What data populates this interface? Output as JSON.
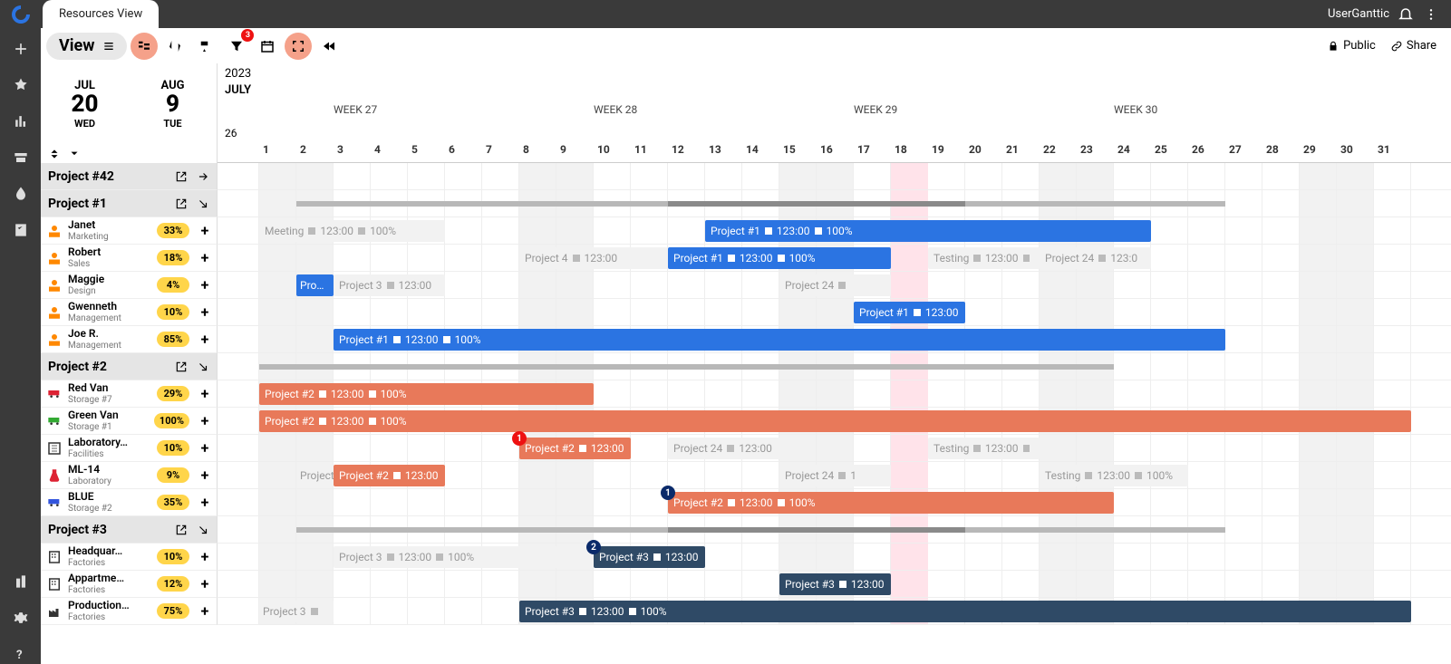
{
  "topbar": {
    "tab": "Resources View",
    "user": "UserGanttic"
  },
  "toolbar": {
    "view": "View",
    "filter_badge": "3",
    "public": "Public",
    "share": "Share"
  },
  "date_left": {
    "month": "JUL",
    "day": "20",
    "wday": "WED"
  },
  "date_right": {
    "month": "AUG",
    "day": "9",
    "wday": "TUE"
  },
  "year": "2023",
  "month_label": "JULY",
  "start_day": "26",
  "weeks": [
    "WEEK 27",
    "WEEK 28",
    "WEEK 29",
    "WEEK 30"
  ],
  "days": [
    "1",
    "2",
    "3",
    "4",
    "5",
    "6",
    "7",
    "8",
    "9",
    "10",
    "11",
    "12",
    "13",
    "14",
    "15",
    "16",
    "17",
    "18",
    "19",
    "20",
    "21",
    "22",
    "23",
    "24",
    "25",
    "26",
    "27",
    "28",
    "29",
    "30",
    "31"
  ],
  "groups": [
    {
      "name": "Project #42",
      "collapsed": false,
      "arrow": "right",
      "summary": []
    },
    {
      "name": "Project #1",
      "collapsed": false,
      "arrow": "down",
      "summary": [
        {
          "start": 1,
          "end": 11,
          "shade": "light"
        },
        {
          "start": 11,
          "end": 19,
          "shade": "dark"
        },
        {
          "start": 19,
          "end": 26,
          "shade": "light"
        }
      ],
      "resources": [
        {
          "name": "Janet",
          "role": "Marketing",
          "util": "33%",
          "icon": "person-orange",
          "tasks": [
            {
              "label": "Meeting ◼ 123:00 ◼ 100%",
              "start": 0,
              "end": 5,
              "cls": "ghost"
            },
            {
              "label": "Project #1 ◼ 123:00 ◼ 100%",
              "start": 12,
              "end": 24,
              "cls": "blue"
            }
          ]
        },
        {
          "name": "Robert",
          "role": "Sales",
          "util": "18%",
          "icon": "person-orange",
          "tasks": [
            {
              "label": "Project 4 ◼ 123:00",
              "start": 7,
              "end": 11,
              "cls": "ghost"
            },
            {
              "label": "Project #1 ◼ 123:00 ◼ 100%",
              "start": 11,
              "end": 17,
              "cls": "blue"
            },
            {
              "label": "Testing ◼ 123:00 ◼",
              "start": 18,
              "end": 21,
              "cls": "ghost"
            },
            {
              "label": "Project 24 ◼ 123:0",
              "start": 21,
              "end": 24,
              "cls": "ghost"
            }
          ]
        },
        {
          "name": "Maggie",
          "role": "Design",
          "util": "4%",
          "icon": "person-orange",
          "tasks": [
            {
              "label": "Pro…",
              "start": 1,
              "end": 2,
              "cls": "blue tiny"
            },
            {
              "label": "Project 3 ◼ 123:00",
              "start": 2,
              "end": 5,
              "cls": "ghost"
            },
            {
              "label": "Project 24 ◼",
              "start": 14,
              "end": 17,
              "cls": "ghost"
            }
          ]
        },
        {
          "name": "Gwenneth",
          "role": "Management",
          "util": "10%",
          "icon": "person-orange",
          "tasks": [
            {
              "label": "Project #1 ◼ 123:00",
              "start": 16,
              "end": 19,
              "cls": "blue"
            }
          ]
        },
        {
          "name": "Joe R.",
          "role": "Management",
          "util": "85%",
          "icon": "person-orange",
          "tasks": [
            {
              "label": "Project #1 ◼ 123:00 ◼ 100%",
              "start": 2,
              "end": 26,
              "cls": "blue"
            }
          ]
        }
      ]
    },
    {
      "name": "Project #2",
      "collapsed": false,
      "arrow": "down",
      "summary": [
        {
          "start": 0,
          "end": 9,
          "shade": "light"
        },
        {
          "start": 9,
          "end": 23,
          "shade": "light"
        }
      ],
      "resources": [
        {
          "name": "Red Van",
          "role": "Storage #7",
          "util": "29%",
          "icon": "van-red",
          "tasks": [
            {
              "label": "Project #2 ◼ 123:00 ◼ 100%",
              "start": 0,
              "end": 9,
              "cls": "orange"
            }
          ]
        },
        {
          "name": "Green Van",
          "role": "Storage #1",
          "util": "100%",
          "icon": "van-green",
          "tasks": [
            {
              "label": "Project #2 ◼ 123:00 ◼ 100%",
              "start": 0,
              "end": 31,
              "cls": "orange"
            }
          ]
        },
        {
          "name": "Laboratory…",
          "role": "Facilities",
          "util": "10%",
          "icon": "lab",
          "tasks": [
            {
              "label": "Project #2 ◼ 123:00",
              "start": 7,
              "end": 10,
              "cls": "orange",
              "marker": "1",
              "marker_cls": "red"
            },
            {
              "label": "Project 24 ◼ 123:00",
              "start": 11,
              "end": 14,
              "cls": "ghost"
            },
            {
              "label": "Testing ◼ 123:00 ◼",
              "start": 18,
              "end": 21,
              "cls": "ghost"
            }
          ]
        },
        {
          "name": "ML-14",
          "role": "Laboratory",
          "util": "9%",
          "icon": "beaker",
          "tasks": [
            {
              "label": "Project",
              "start": 1,
              "end": 2,
              "cls": "ghost tiny"
            },
            {
              "label": "Project #2 ◼ 123:00",
              "start": 2,
              "end": 5,
              "cls": "orange"
            },
            {
              "label": "Project 24 ◼ 1",
              "start": 14,
              "end": 17,
              "cls": "ghost"
            },
            {
              "label": "Testing ◼ 123:00 ◼ 100%",
              "start": 21,
              "end": 25,
              "cls": "ghost"
            }
          ]
        },
        {
          "name": "BLUE",
          "role": "Storage #2",
          "util": "35%",
          "icon": "van-blue",
          "tasks": [
            {
              "label": "Project #2 ◼ 123:00 ◼ 100%",
              "start": 11,
              "end": 23,
              "cls": "orange",
              "marker": "1",
              "marker_cls": ""
            }
          ]
        }
      ]
    },
    {
      "name": "Project #3",
      "collapsed": false,
      "arrow": "down",
      "summary": [
        {
          "start": 1,
          "end": 11,
          "shade": "light"
        },
        {
          "start": 11,
          "end": 19,
          "shade": "dark"
        },
        {
          "start": 19,
          "end": 26,
          "shade": "light"
        }
      ],
      "resources": [
        {
          "name": "Headquar…",
          "role": "Factories",
          "util": "10%",
          "icon": "building",
          "tasks": [
            {
              "label": "Project 3 ◼ 123:00 ◼ 100%",
              "start": 2,
              "end": 9,
              "cls": "ghost"
            },
            {
              "label": "Project #3 ◼ 123:00",
              "start": 9,
              "end": 12,
              "cls": "navy",
              "marker": "2",
              "marker_cls": ""
            }
          ]
        },
        {
          "name": "Appartme…",
          "role": "Factories",
          "util": "12%",
          "icon": "building",
          "tasks": [
            {
              "label": "Project #3 ◼ 123:00",
              "start": 14,
              "end": 17,
              "cls": "navy"
            }
          ]
        },
        {
          "name": "Production…",
          "role": "Factories",
          "util": "75%",
          "icon": "factory",
          "tasks": [
            {
              "label": "Project 3 ◼",
              "start": 0,
              "end": 2,
              "cls": "ghost tiny"
            },
            {
              "label": "Project #3 ◼ 123:00 ◼ 100%",
              "start": 7,
              "end": 31,
              "cls": "navy"
            }
          ]
        }
      ]
    }
  ],
  "weekend_indices": [
    0,
    1,
    7,
    8,
    14,
    15,
    21,
    22,
    28,
    29
  ],
  "holiday_index": 17
}
